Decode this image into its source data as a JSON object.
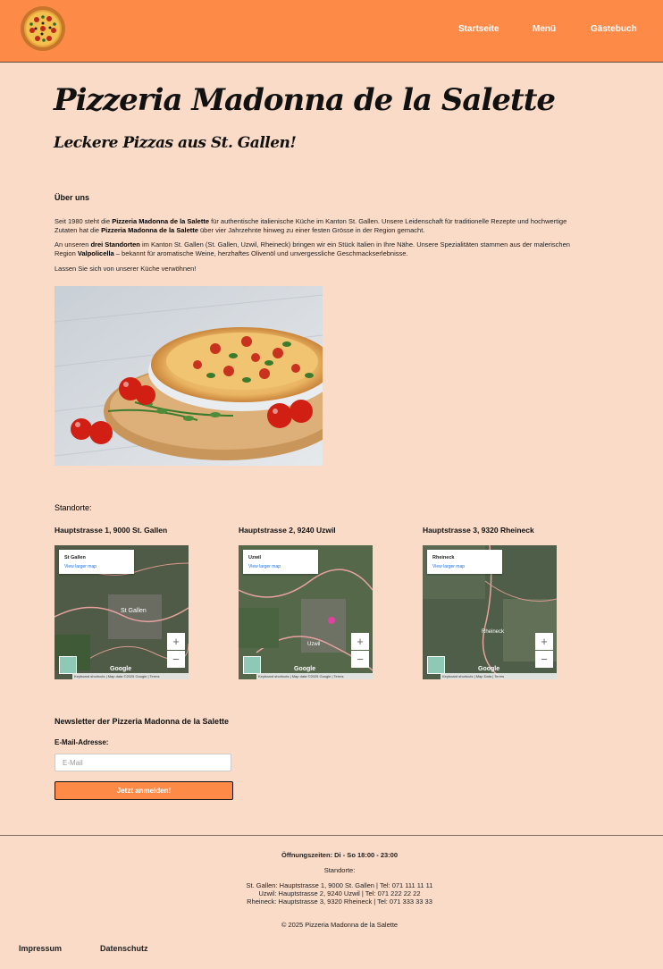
{
  "header": {
    "nav": [
      "Startseite",
      "Menü",
      "Gästebuch"
    ],
    "bg_color": "#fe8a48",
    "logo_icon": "pizza-logo-icon"
  },
  "hero": {
    "title": "Pizzeria Madonna de la Salette",
    "subtitle": "Leckere Pizzas aus St. Gallen!"
  },
  "about": {
    "heading": "Über uns",
    "p1_a": "Seit 1980 steht die ",
    "p1_b": "Pizzeria Madonna de la Salette",
    "p1_c": " für authentische italienische Küche im Kanton St. Gallen. Unsere Leidenschaft für traditionelle Rezepte und hochwertige Zutaten hat die ",
    "p1_d": "Pizzeria Madonna de la Salette",
    "p1_e": " über vier Jahrzehnte hinweg zu einer festen Grösse in der Region gemacht.",
    "p2_a": "An unseren ",
    "p2_b": "drei Standorten",
    "p2_c": " im Kanton St. Gallen (St. Gallen, Uzwil, Rheineck) bringen wir ein Stück Italien in Ihre Nähe. Unsere Spezialitäten stammen aus der malerischen Region ",
    "p2_d": "Valpolicella",
    "p2_e": " – bekannt für aromatische Weine, herzhaftes Olivenöl und unvergessliche Geschmackserlebnisse.",
    "p3": "Lassen Sie sich von unserer Küche verwöhnen!"
  },
  "locations": {
    "heading": "Standorte:",
    "items": [
      {
        "title": "Hauptstrasse 1, 9000 St. Gallen",
        "map_name": "St Gallen",
        "map_label": "St Gallen",
        "attr": "Keyboard shortcuts  |  Map data ©2025 Google  |  Terms"
      },
      {
        "title": "Hauptstrasse 2, 9240 Uzwil",
        "map_name": "Uzwil",
        "map_label": "Uzwil",
        "attr": "Keyboard shortcuts  |  Map data ©2025 Google  |  Terms"
      },
      {
        "title": "Hauptstrasse 3, 9320 Rheineck",
        "map_name": "Rheineck",
        "map_label": "Rheineck",
        "attr": "Keyboard shortcuts  |  Map Data  |  Terms"
      }
    ],
    "view_larger": "View larger map",
    "google": "Google",
    "zoom_in": "+",
    "zoom_out": "−"
  },
  "newsletter": {
    "heading": "Newsletter der Pizzeria Madonna de la Salette",
    "label": "E-Mail-Adresse:",
    "placeholder": "E-Mail",
    "button": "Jetzt anmelden!"
  },
  "footer": {
    "hours": "Öffnungszeiten: Di - So 18:00 - 23:00",
    "locations_heading": "Standorte:",
    "lines": [
      "St. Gallen: Hauptstrasse 1, 9000 St. Gallen | Tel: 071 111 11 11",
      "Uzwil: Hauptstrasse 2, 9240 Uzwil | Tel: 071 222 22 22",
      "Rheineck: Hauptstrasse 3, 9320 Rheineck | Tel: 071 333 33 33"
    ],
    "copyright": "© 2025 Pizzeria Madonna de la Salette",
    "links": [
      "Impressum",
      "Datenschutz"
    ]
  }
}
